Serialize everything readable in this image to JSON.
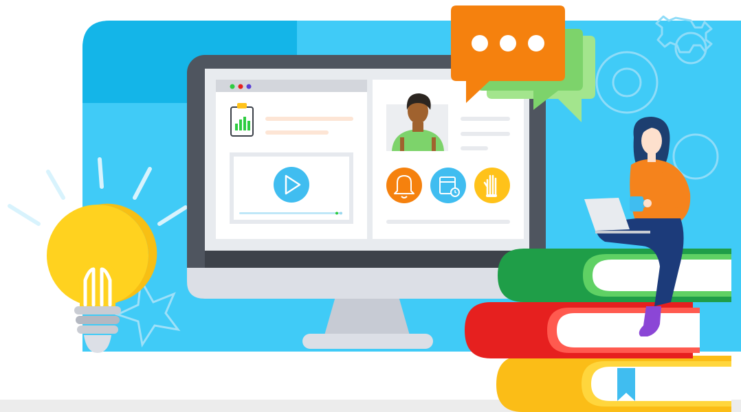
{
  "scene": {
    "description_label": "",
    "colors": {
      "sky": "#40cbf7",
      "sky_dark": "#14b5e8",
      "monitor_frame": "#4f555f",
      "monitor_stand": "#dcdfe6",
      "screen_bg": "#ffffff",
      "chat_orange": "#f5810e",
      "chat_green": "#7dd36b",
      "bulb_yellow": "#ffd21f",
      "book_green": "#1f9e48",
      "book_red": "#e6201f",
      "book_yellow": "#fbbd17",
      "person_shirt": "#f5831c",
      "person_jeans": "#1c3b7a",
      "person_hair": "#1d3f70"
    },
    "screen": {
      "left_panel": {
        "dots_colors": [
          "#2ecc40",
          "#e6201f",
          "#5a3fd6"
        ],
        "chart_icon": "chart-clipboard-icon",
        "video_icon": "play-icon"
      },
      "right_panel": {
        "avatar_icon": "avatar",
        "action_icons": [
          {
            "name": "bell-icon",
            "color": "#f5810e"
          },
          {
            "name": "calendar-icon",
            "color": "#40bdf0"
          },
          {
            "name": "raised-hand-icon",
            "color": "#ffc21a"
          }
        ]
      }
    },
    "decor": {
      "chat_icon": "speech-bubble-icon",
      "gear_icon": "gear-icon",
      "bulb_icon": "lightbulb-icon",
      "bookmark_icon": "bookmark-icon"
    }
  }
}
